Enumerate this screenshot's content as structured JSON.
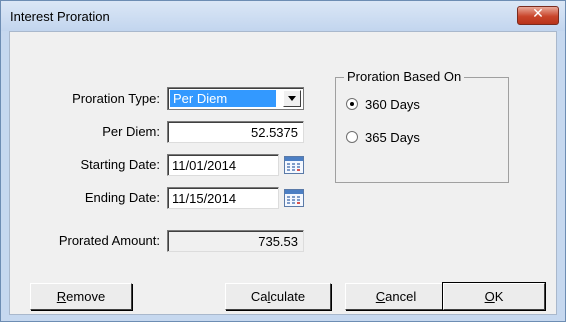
{
  "window": {
    "title": "Interest Proration",
    "close_glyph": "✕"
  },
  "form": {
    "proration_type_label": "Proration Type:",
    "proration_type_value": "Per Diem",
    "per_diem_label": "Per Diem:",
    "per_diem_value": "52.5375",
    "starting_date_label": "Starting Date:",
    "starting_date_value": "11/01/2014",
    "ending_date_label": "Ending Date:",
    "ending_date_value": "11/15/2014",
    "prorated_amount_label": "Prorated Amount:",
    "prorated_amount_value": "735.53"
  },
  "group": {
    "title": "Proration Based On",
    "options": [
      {
        "label": "360 Days",
        "checked": true
      },
      {
        "label": "365 Days",
        "checked": false
      }
    ]
  },
  "buttons": {
    "remove": {
      "first": "R",
      "rest": "emove"
    },
    "calculate": {
      "pre": "Ca",
      "mn": "l",
      "post": "culate"
    },
    "cancel": {
      "first": "C",
      "rest": "ancel"
    },
    "ok": {
      "first": "O",
      "rest": "K"
    }
  },
  "icons": {
    "close": "close-icon",
    "calendar": "calendar-icon",
    "dropdown": "chevron-down-icon"
  }
}
